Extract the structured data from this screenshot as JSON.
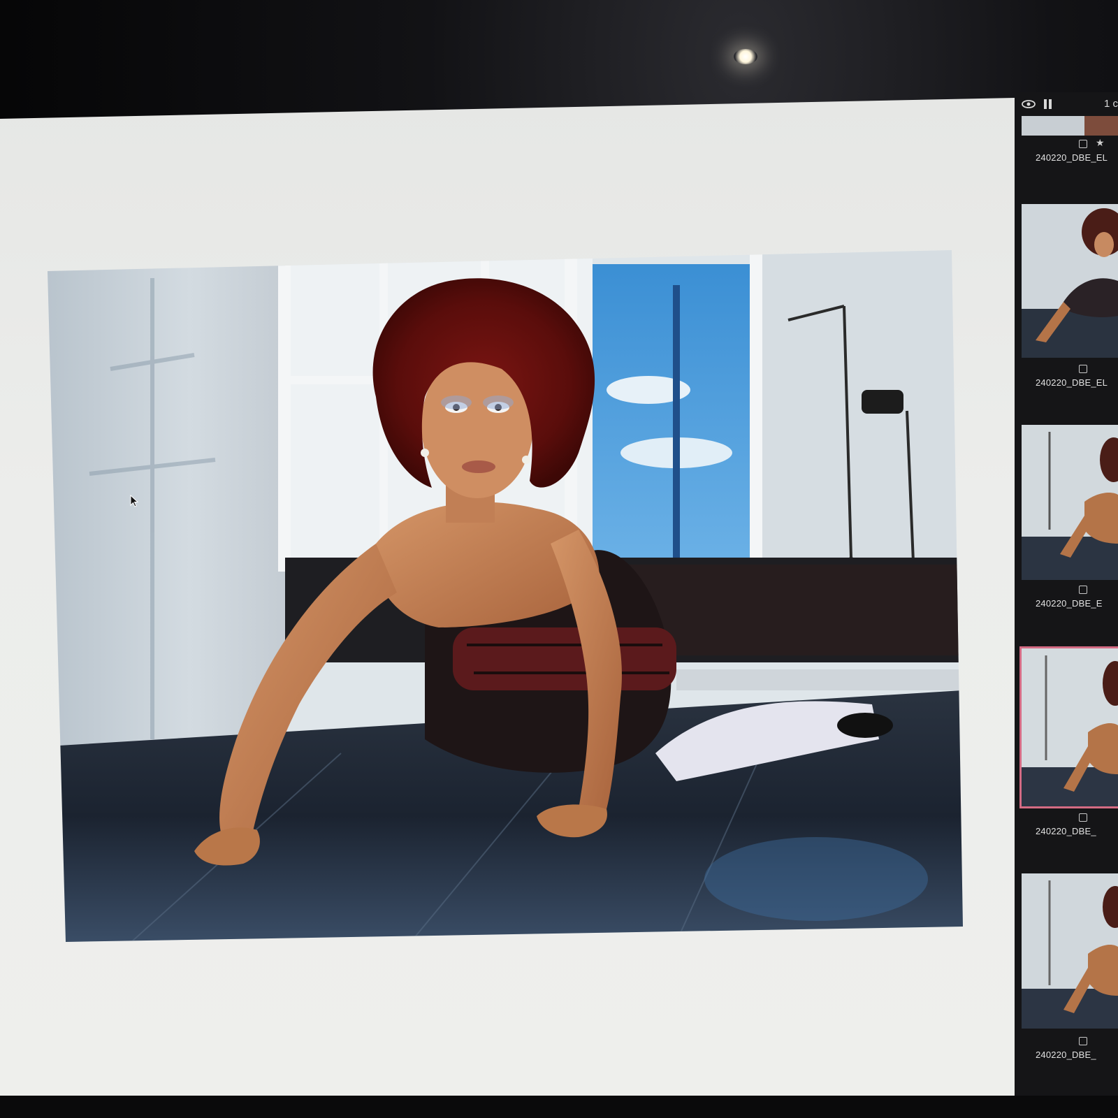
{
  "viewer": {
    "background": "#ecedeb"
  },
  "filmstrip": {
    "page_counter": "1 c",
    "items": [
      {
        "filename": "240220_DBE_EL",
        "selected": false,
        "starred": true
      },
      {
        "filename": "240220_DBE_EL",
        "selected": false,
        "starred": false
      },
      {
        "filename": "240220_DBE_E",
        "selected": false,
        "starred": false
      },
      {
        "filename": "240220_DBE_",
        "selected": true,
        "starred": false
      },
      {
        "filename": "240220_DBE_",
        "selected": false,
        "starred": false
      }
    ],
    "selection_color": "#d46b84"
  }
}
